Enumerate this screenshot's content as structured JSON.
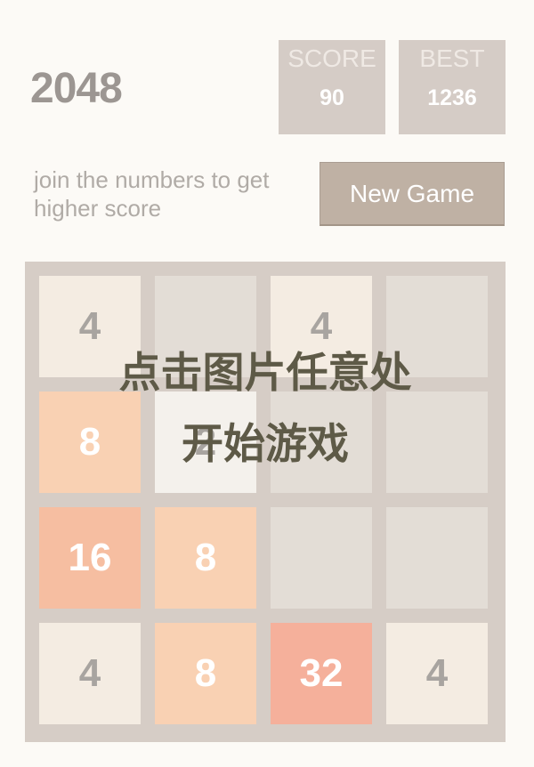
{
  "header": {
    "title": "2048",
    "score_label": "SCORE",
    "score_value": "90",
    "best_label": "BEST",
    "best_value": "1236"
  },
  "intro": {
    "tagline": "join the numbers to get higher score",
    "new_game_label": "New Game"
  },
  "board": {
    "size": 4,
    "cells": [
      [
        "4",
        "",
        "4",
        ""
      ],
      [
        "8",
        "2",
        "",
        ""
      ],
      [
        "16",
        "8",
        "",
        ""
      ],
      [
        "4",
        "8",
        "32",
        "4"
      ]
    ]
  },
  "overlay": {
    "line1": "点击图片任意处",
    "line2": "开始游戏"
  },
  "colors": {
    "empty": "#e3ddd6",
    "tile_2": "#f4f1ec",
    "tile_4": "#f4ece2",
    "tile_8": "#f9d1b3",
    "tile_16": "#f6bea1",
    "tile_32": "#f5b09b",
    "dark_text": "#a8a4a0",
    "light_text": "#ffffff",
    "overlay_text": "#5e5a47"
  }
}
